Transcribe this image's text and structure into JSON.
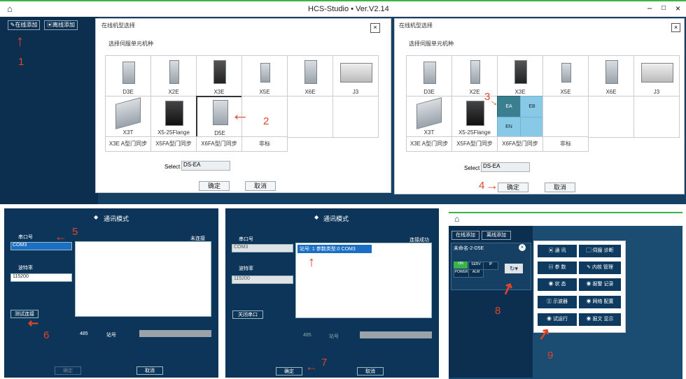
{
  "window": {
    "title": "HCS-Studio • Ver.V2.14",
    "controls": [
      "–",
      "□",
      "×"
    ]
  },
  "topbar": {
    "online_add": "在线添加",
    "offline_add": "离线添加"
  },
  "dialog_left": {
    "title": "在线机型选择",
    "subtitle": "选择伺服单元机种",
    "close": "×",
    "row1": [
      "D3E",
      "X2E",
      "X3E",
      "X5E",
      "X6E",
      "J3"
    ],
    "row2": [
      "X3T",
      "X5-25Flange",
      "D5E"
    ],
    "row3": [
      "X3E A型门同步",
      "X5FA型门同步",
      "X6FA型门同步",
      "非标"
    ],
    "select_label": "Select",
    "select_value": "DS-EA",
    "ok": "确定",
    "cancel": "取消"
  },
  "dialog_right": {
    "title": "在线机型选择",
    "subtitle": "选择伺服单元机种",
    "close": "×",
    "row1": [
      "D3E",
      "X2E",
      "X3E",
      "X5E",
      "X6E",
      "J3"
    ],
    "row2": [
      "X3T",
      "X5-25Flange"
    ],
    "sub_options": [
      "EA",
      "EB",
      "EN"
    ],
    "row3": [
      "X3E A型门同步",
      "X5FA型门同步",
      "X6FA型门同步",
      "非标"
    ],
    "select_label": "Select",
    "select_value": "DS-EA",
    "ok": "确定",
    "cancel": "取消"
  },
  "comm_left": {
    "title": "通讯模式",
    "serial_label": "串口号",
    "serial_value": "COM3",
    "baud_label": "波特率",
    "baud_value": "115200",
    "right_label": "未连接",
    "test_btn": "测试连接",
    "radio1": "485",
    "radio2": "站号",
    "confirm": "确定",
    "cancel": "取消"
  },
  "comm_mid": {
    "title": "通讯模式",
    "serial_label": "串口号",
    "serial_value": "COM3",
    "baud_label": "波特率",
    "baud_value": "115200",
    "right_label": "连接成功",
    "result_text": "站号: 1    参数类型:0  COM3",
    "close_port": "关闭串口",
    "radio1": "485",
    "radio2": "站号",
    "confirm": "确定",
    "cancel": "取消"
  },
  "device_panel": {
    "online_add": "在线添加",
    "offline_add": "离线添加",
    "device_name": "未命名-2-D5E",
    "status": [
      "ON",
      "SERV",
      "IP",
      "POWER",
      "ALM"
    ],
    "menu": [
      {
        "icon": "comm-icon",
        "label": "通  讯"
      },
      {
        "icon": "scope-icon",
        "label": "伺服 诊断"
      },
      {
        "icon": "param-icon",
        "label": "参  数"
      },
      {
        "icon": "io-icon",
        "label": "内核 管理"
      },
      {
        "icon": "status-icon",
        "label": "状  态"
      },
      {
        "icon": "alarm-icon",
        "label": "报警 记录"
      },
      {
        "icon": "wave-icon",
        "label": "示波器"
      },
      {
        "icon": "net-icon",
        "label": "网络 配置"
      },
      {
        "icon": "run-icon",
        "label": "试运行"
      },
      {
        "icon": "msg-icon",
        "label": "报文 显示"
      }
    ]
  },
  "annotations": [
    "1",
    "2",
    "3",
    "4",
    "5",
    "6",
    "7",
    "8",
    "9"
  ],
  "colors": {
    "dark": "#0f3a5f",
    "darker": "#0b2e4d",
    "accent_red": "#e0452a",
    "highlight": "#88c9e6",
    "green_line": "#3bb34a"
  }
}
